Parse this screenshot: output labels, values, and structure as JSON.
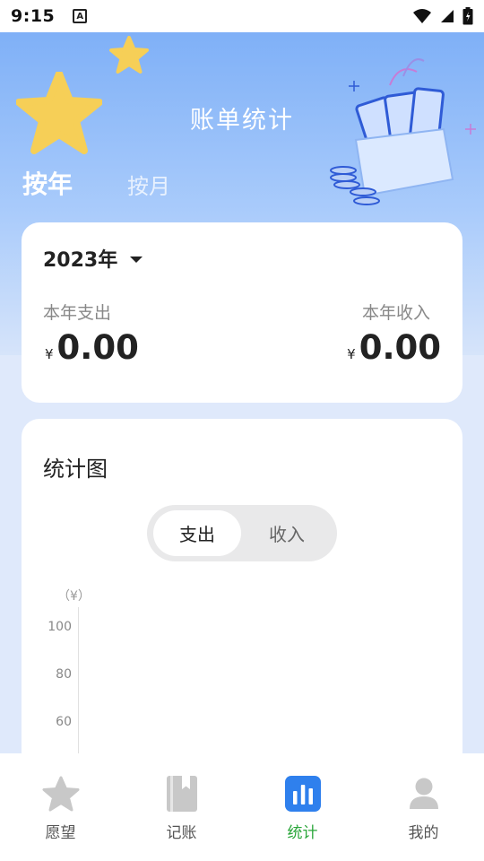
{
  "status_bar": {
    "time": "9:15",
    "indicator": "A"
  },
  "header": {
    "title": "账单统计",
    "tabs": [
      {
        "label": "按年",
        "active": true
      },
      {
        "label": "按月",
        "active": false
      }
    ]
  },
  "summary": {
    "year": "2023年",
    "expense_label": "本年支出",
    "income_label": "本年收入",
    "currency": "¥",
    "expense_value": "0.00",
    "income_value": "0.00"
  },
  "chart": {
    "title": "统计图",
    "toggle": {
      "expense": "支出",
      "income": "收入",
      "selected": "支出"
    },
    "unit": "（¥）"
  },
  "chart_data": {
    "type": "bar",
    "title": "统计图",
    "ylabel": "（¥）",
    "yticks": [
      "100",
      "80",
      "60"
    ],
    "ylim": [
      0,
      100
    ],
    "categories": [],
    "values": []
  },
  "nav": {
    "items": [
      {
        "label": "愿望",
        "icon": "star-icon"
      },
      {
        "label": "记账",
        "icon": "ledger-book-icon"
      },
      {
        "label": "统计",
        "icon": "bar-chart-icon",
        "active": true
      },
      {
        "label": "我的",
        "icon": "user-icon"
      }
    ],
    "active_color": "#2aa63a",
    "icon_color": "#c8c8c8"
  },
  "colors": {
    "accent": "#2f80ed",
    "hero_top": "#7fb0f7"
  }
}
